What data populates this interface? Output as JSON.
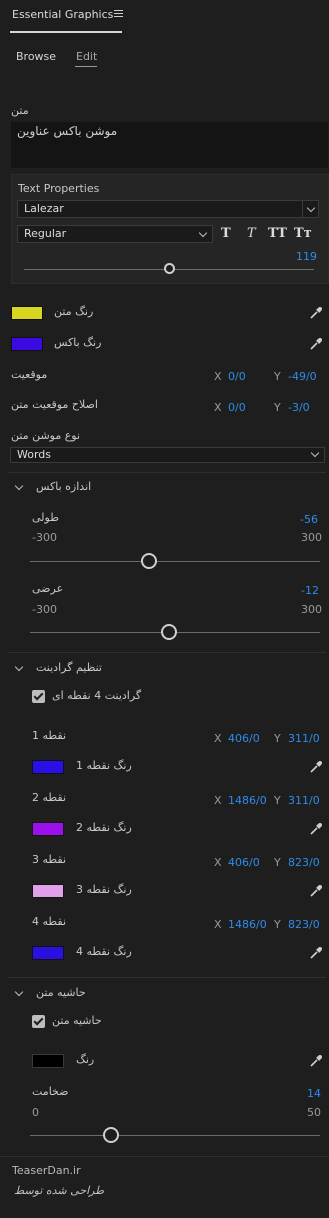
{
  "panel": {
    "title": "Essential Graphics"
  },
  "tabs": {
    "browse": "Browse",
    "edit": "Edit"
  },
  "text_section": {
    "label": "متن",
    "value": "موشن باکس عناوین"
  },
  "text_properties": {
    "title": "Text Properties",
    "font": "Lalezar",
    "style": "Regular",
    "style_buttons": [
      "T",
      "T",
      "TT",
      "Tт"
    ],
    "size": "119",
    "size_fraction": 0.5
  },
  "text_color": {
    "label": "رنگ متن",
    "color": "#d8d520"
  },
  "box_color": {
    "label": "رنگ باکس",
    "color": "#3a0ae0"
  },
  "position": {
    "label": "موقعیت",
    "x_label": "X",
    "x": "0/0",
    "y_label": "Y",
    "y": "-49/0"
  },
  "position_fix": {
    "label": "اصلاح موقعیت متن",
    "x_label": "X",
    "x": "0/0",
    "y_label": "Y",
    "y": "-3/0"
  },
  "motion_type": {
    "label": "نوع موشن متن",
    "value": "Words"
  },
  "box_size": {
    "title": "اندازه باکس",
    "length": {
      "label": "طولی",
      "value": "-56",
      "min": "-300",
      "max": "300",
      "fraction": 0.41
    },
    "width": {
      "label": "عرضی",
      "value": "-12",
      "min": "-300",
      "max": "300",
      "fraction": 0.48
    }
  },
  "gradient": {
    "title": "تنظیم گرادینت",
    "checkbox_label": "گرادینت 4 نقطه ای",
    "points": [
      {
        "label": "نقطه 1",
        "x": "406/0",
        "y": "311/0",
        "color_label": "رنگ نقطه 1",
        "color": "#2a10e8"
      },
      {
        "label": "نقطه 2",
        "x": "1486/0",
        "y": "311/0",
        "color_label": "رنگ نقطه 2",
        "color": "#9b10ec"
      },
      {
        "label": "نقطه 3",
        "x": "406/0",
        "y": "823/0",
        "color_label": "رنگ نقطه 3",
        "color": "#e0a0ea"
      },
      {
        "label": "نقطه 4",
        "x": "1486/0",
        "y": "823/0",
        "color_label": "رنگ نقطه 4",
        "color": "#2a10e0"
      }
    ]
  },
  "text_border": {
    "title": "حاشیه متن",
    "checkbox_label": "حاشیه متن",
    "color_label": "رنگ",
    "color": "#000000",
    "thickness": {
      "label": "ضخامت",
      "value": "14",
      "min": "0",
      "max": "50",
      "fraction": 0.28
    }
  },
  "footer": {
    "site": "TeaserDan.ir",
    "credit": "طراحی شده توسط"
  }
}
